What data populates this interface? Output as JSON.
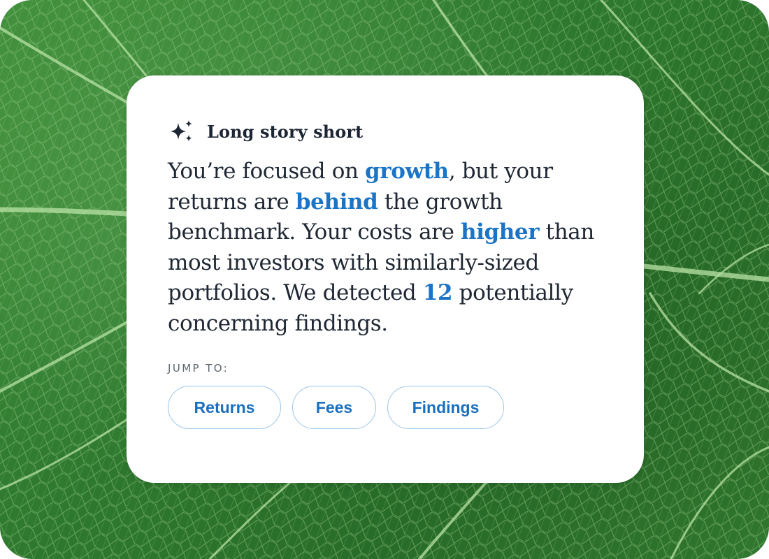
{
  "card": {
    "title": "Long story short",
    "icon": "sparkle-icon",
    "summary": [
      {
        "text": "You’re focused on ",
        "highlight": false
      },
      {
        "text": "growth",
        "highlight": true
      },
      {
        "text": ", but your returns are ",
        "highlight": false
      },
      {
        "text": "behind",
        "highlight": true
      },
      {
        "text": " the growth benchmark. Your costs are ",
        "highlight": false
      },
      {
        "text": "higher",
        "highlight": true
      },
      {
        "text": " than most investors with similarly-sized portfolios. We detected ",
        "highlight": false
      },
      {
        "text": "12",
        "highlight": true
      },
      {
        "text": " potentially concerning findings.",
        "highlight": false
      }
    ],
    "jump_label": "JUMP TO:",
    "buttons": [
      "Returns",
      "Fees",
      "Findings"
    ]
  },
  "colors": {
    "accent": "#1b74c5",
    "pill_border": "#9cc6ea",
    "body_text": "#1e2733",
    "background_leaf": "#2f7a2f"
  }
}
